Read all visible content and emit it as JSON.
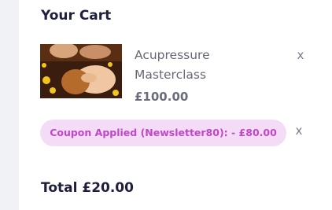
{
  "cart": {
    "title": "Your Cart",
    "item": {
      "name": "Acupressure Masterclass",
      "price": "£100.00",
      "remove_symbol": "x",
      "image_icon": "spa-massage-photo"
    },
    "coupon": {
      "text": "Coupon Applied (Newsletter80): - £80.00",
      "remove_symbol": "x"
    },
    "total": "Total £20.00"
  },
  "colors": {
    "background": "#f1f2f6",
    "panel": "#ffffff",
    "heading": "#1d1f3b",
    "coupon_bg": "#f4dcf6",
    "coupon_text": "#c146c8"
  }
}
